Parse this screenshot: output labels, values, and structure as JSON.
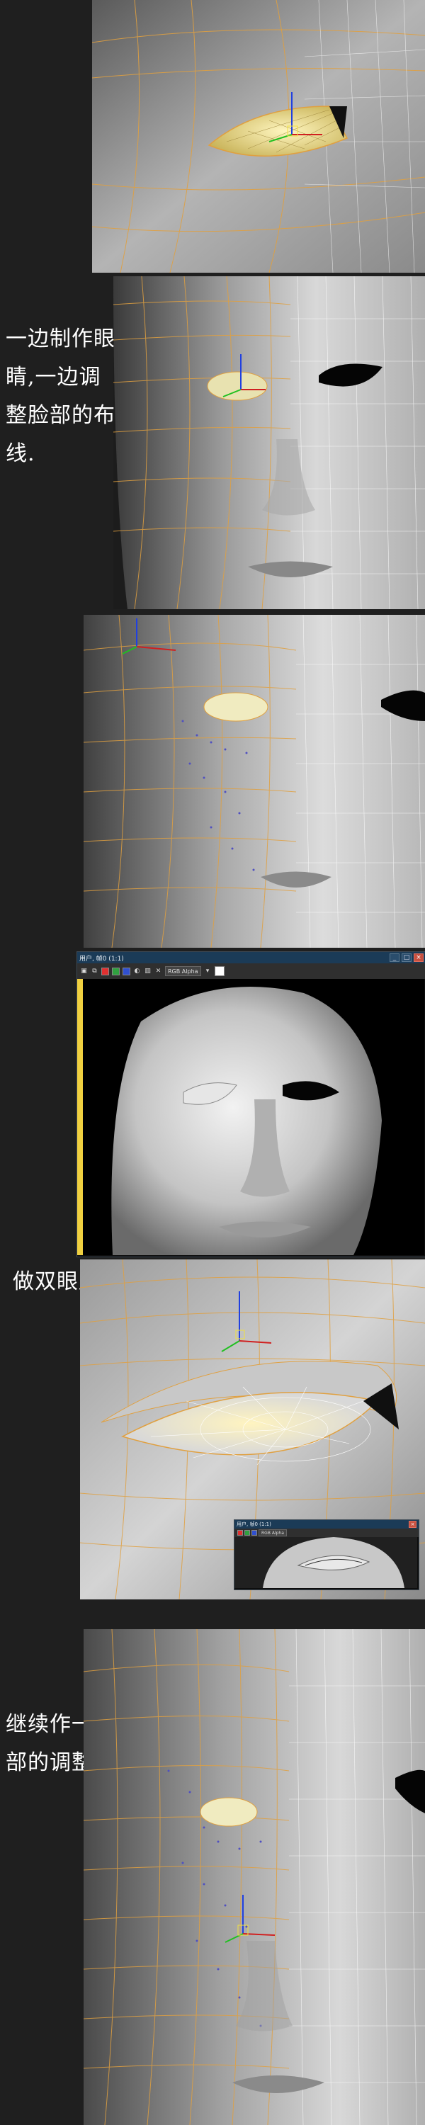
{
  "captions": {
    "c1": [
      "一边制作眼",
      "睛,一边调",
      "整脸部的布",
      "线."
    ],
    "c2": [
      "做双眼皮."
    ],
    "c3": [
      "继续作一些局",
      "部的调整."
    ]
  },
  "render_window": {
    "title": "用户, 帧0 (1:1)",
    "channel": "RGB Alpha",
    "swatches": [
      "#e03030",
      "#30a040",
      "#3050d0"
    ]
  },
  "small_window": {
    "title": "用户, 帧0 (1:1)",
    "channel": "RGB Alpha"
  },
  "colors": {
    "background": "#1f1f1f",
    "wire_orange": "#e0a040",
    "wire_white": "#ffffff",
    "gizmo_x": "#d02020",
    "gizmo_y": "#20c020",
    "gizmo_z": "#2040e0",
    "selection_yellow": "#f0e08a"
  },
  "icons": [
    "move-gizmo-icon",
    "toolbar-save-icon",
    "toolbar-copy-icon",
    "close-icon",
    "minimize-icon",
    "maximize-icon"
  ]
}
